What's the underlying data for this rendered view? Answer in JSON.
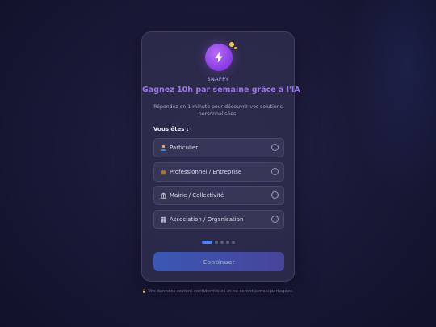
{
  "brand": {
    "name": "SNAPPY",
    "logo_icon": "bolt-icon",
    "accent": "#8b3ee4"
  },
  "headline": "Gagnez 10h par semaine grâce à l'IA",
  "subtitle": "Répondez en 1 minute pour découvrir vos solutions personnalisées.",
  "question": "Vous êtes :",
  "options": [
    {
      "icon": "person-icon",
      "label": "Particulier"
    },
    {
      "icon": "briefcase-icon",
      "label": "Professionnel / Entreprise"
    },
    {
      "icon": "government-building-icon",
      "label": "Mairie / Collectivité"
    },
    {
      "icon": "office-building-icon",
      "label": "Association / Organisation"
    }
  ],
  "progress": {
    "step": 1,
    "total": 5,
    "active_color": "#4f7ff0"
  },
  "continue_label": "Continuer",
  "footer": {
    "icon": "lock-icon",
    "text": "Vos données restent confidentielles et ne seront jamais partagées."
  }
}
